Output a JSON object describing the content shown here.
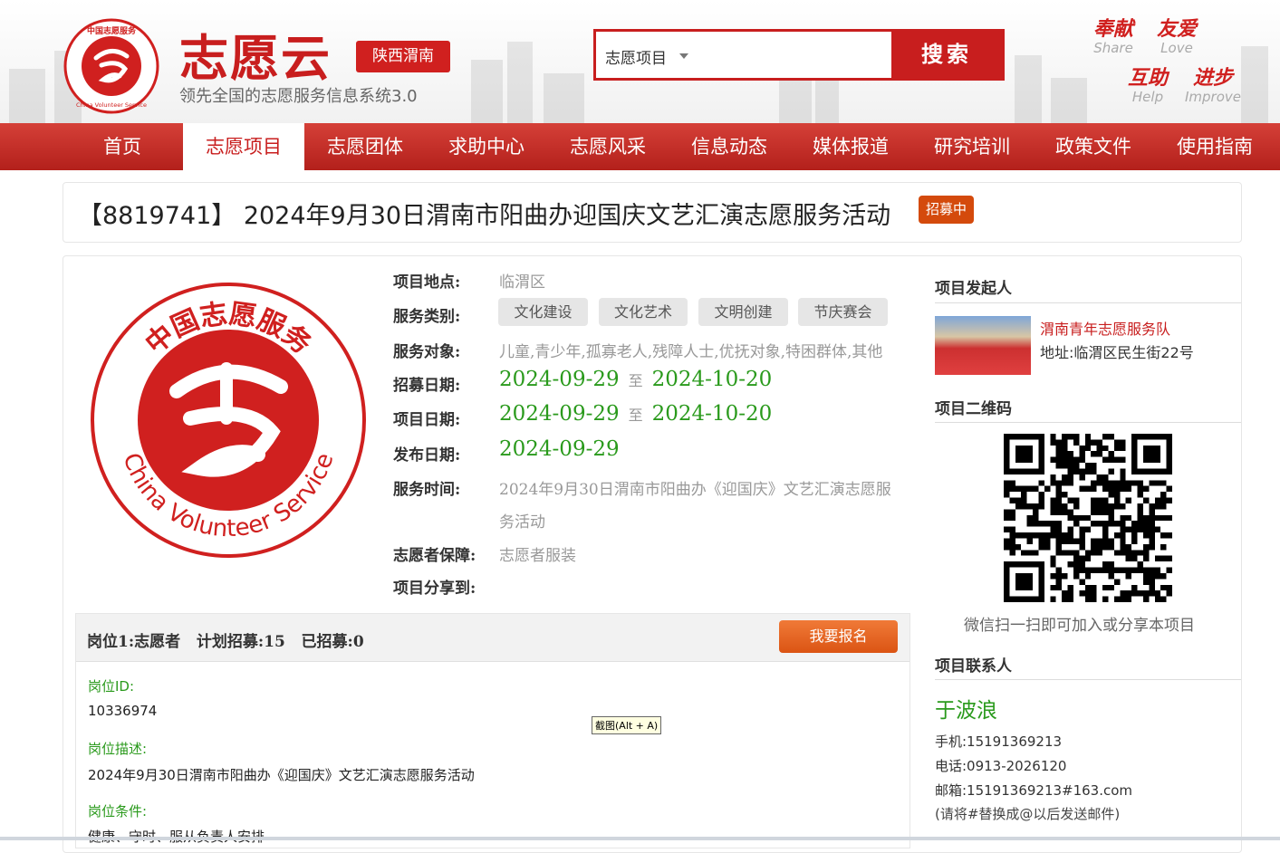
{
  "header": {
    "brand": "志愿云",
    "region": "陕西渭南",
    "slogan": "领先全国的志愿服务信息系统3.0",
    "search": {
      "category": "志愿项目",
      "button": "搜索"
    },
    "values": [
      {
        "cn": "奉献",
        "en": "Share"
      },
      {
        "cn": "友爱",
        "en": "Love"
      },
      {
        "cn": "互助",
        "en": "Help"
      },
      {
        "cn": "进步",
        "en": "Improve"
      }
    ],
    "logo_text": {
      "top": "中国志愿服务",
      "bottom": "China Volunteer Service"
    }
  },
  "nav": [
    "首页",
    "志愿项目",
    "志愿团体",
    "求助中心",
    "志愿风采",
    "信息动态",
    "媒体报道",
    "研究培训",
    "政策文件",
    "使用指南"
  ],
  "nav_active_index": 1,
  "project": {
    "title": "【8819741】 2024年9月30日渭南市阳曲办迎国庆文艺汇演志愿服务活动",
    "status": "招募中",
    "location_label": "项目地点:",
    "location": "临渭区",
    "category_label": "服务类别:",
    "categories": [
      "文化建设",
      "文化艺术",
      "文明创建",
      "节庆赛会"
    ],
    "target_label": "服务对象:",
    "target": "儿童,青少年,孤寡老人,残障人士,优抚对象,特困群体,其他",
    "recruit_label": "招募日期:",
    "recruit_start": "2024-09-29",
    "recruit_end": "2024-10-20",
    "project_label": "项目日期:",
    "project_start": "2024-09-29",
    "project_end": "2024-10-20",
    "to": "至",
    "publish_label": "发布日期:",
    "publish": "2024-09-29",
    "time_label": "服务时间:",
    "time_line1": "2024年9月30日渭南市阳曲办《迎国庆》文艺汇演志愿服",
    "time_line2": "务活动",
    "guarantee_label": "志愿者保障:",
    "guarantee": "志愿者服装",
    "share_label": "项目分享到:"
  },
  "job": {
    "header": "岗位1:志愿者   计划招募:15   已招募:0",
    "signup": "我要报名",
    "id_label": "岗位ID:",
    "id": "10336974",
    "desc_label": "岗位描述:",
    "desc": "2024年9月30日渭南市阳曲办《迎国庆》文艺汇演志愿服务活动",
    "cond_label": "岗位条件:",
    "cond": "健康、守时、服从负责人安排"
  },
  "tooltip": "截图(Alt + A)",
  "sidebar": {
    "initiator_title": "项目发起人",
    "team_name": "渭南青年志愿服务队",
    "team_address": "地址:临渭区民生街22号",
    "qr_title": "项目二维码",
    "qr_caption": "微信扫一扫即可加入或分享本项目",
    "contact_title": "项目联系人",
    "contact_name": "于波浪",
    "mobile": "手机:15191369213",
    "phone": "电话:0913-2026120",
    "email": "邮箱:15191369213#163.com",
    "email_note": "(请将#替换成@以后发送邮件)"
  },
  "colors": {
    "brand_red": "#c81e1e",
    "date_green": "#2a9a1c",
    "signup_orange": "#db5413"
  }
}
